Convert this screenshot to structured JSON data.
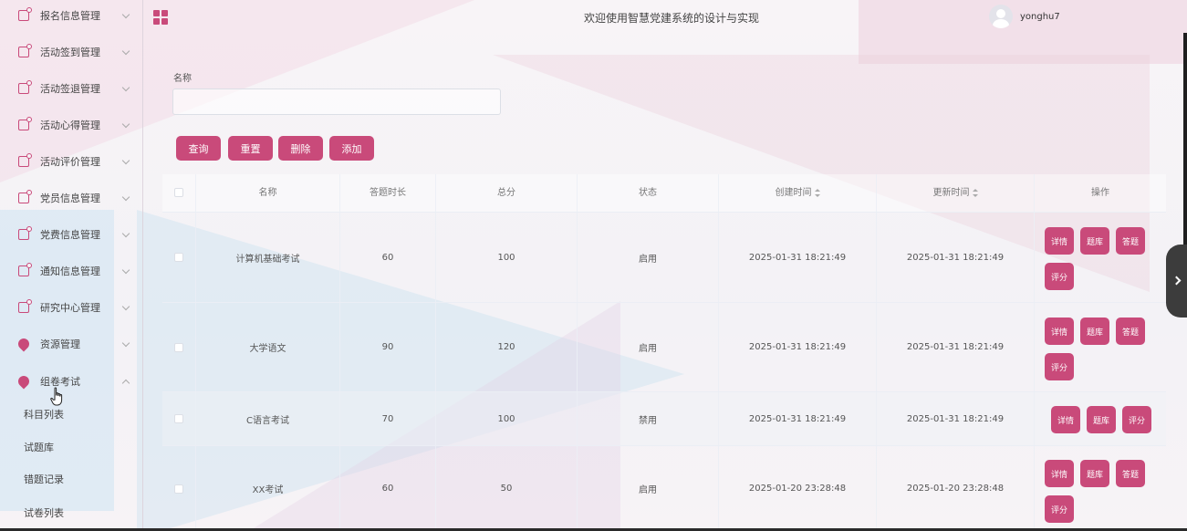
{
  "header": {
    "title": "欢迎使用智慧党建系统的设计与实现",
    "username": "yonghu7"
  },
  "sidebar": {
    "items": [
      {
        "label": "报名信息管理",
        "icon": "doc-icon"
      },
      {
        "label": "活动签到管理",
        "icon": "doc-icon"
      },
      {
        "label": "活动签退管理",
        "icon": "doc-icon"
      },
      {
        "label": "活动心得管理",
        "icon": "doc-icon"
      },
      {
        "label": "活动评价管理",
        "icon": "doc-icon"
      },
      {
        "label": "党员信息管理",
        "icon": "doc-icon"
      },
      {
        "label": "党费信息管理",
        "icon": "doc-icon"
      },
      {
        "label": "通知信息管理",
        "icon": "doc-icon"
      },
      {
        "label": "研究中心管理",
        "icon": "doc-icon"
      },
      {
        "label": "资源管理",
        "icon": "pin-icon"
      },
      {
        "label": "组卷考试",
        "icon": "pin-icon",
        "expanded": true
      }
    ],
    "subitems": [
      "科目列表",
      "试题库",
      "错题记录",
      "试卷列表"
    ]
  },
  "search": {
    "label": "名称",
    "value": "",
    "placeholder": ""
  },
  "actions": {
    "query": "查询",
    "reset": "重置",
    "delete": "删除",
    "add": "添加"
  },
  "table": {
    "columns": [
      "名称",
      "答题时长",
      "总分",
      "状态",
      "创建时间",
      "更新时间",
      "操作"
    ],
    "rows": [
      {
        "name": "计算机基础考试",
        "duration": "60",
        "total": "100",
        "status": "启用",
        "created": "2025-01-31 18:21:49",
        "updated": "2025-01-31 18:21:49",
        "ops": [
          "详情",
          "题库",
          "答题",
          "评分"
        ]
      },
      {
        "name": "大学语文",
        "duration": "90",
        "total": "120",
        "status": "启用",
        "created": "2025-01-31 18:21:49",
        "updated": "2025-01-31 18:21:49",
        "ops": [
          "详情",
          "题库",
          "答题",
          "评分"
        ]
      },
      {
        "name": "C语言考试",
        "duration": "70",
        "total": "100",
        "status": "禁用",
        "created": "2025-01-31 18:21:49",
        "updated": "2025-01-31 18:21:49",
        "ops": [
          "详情",
          "题库",
          "评分"
        ]
      },
      {
        "name": "XX考试",
        "duration": "60",
        "total": "50",
        "status": "启用",
        "created": "2025-01-20 23:28:48",
        "updated": "2025-01-20 23:28:48",
        "ops": [
          "详情",
          "题库",
          "答题",
          "评分"
        ]
      }
    ]
  },
  "colors": {
    "accent": "#c94a7a"
  }
}
